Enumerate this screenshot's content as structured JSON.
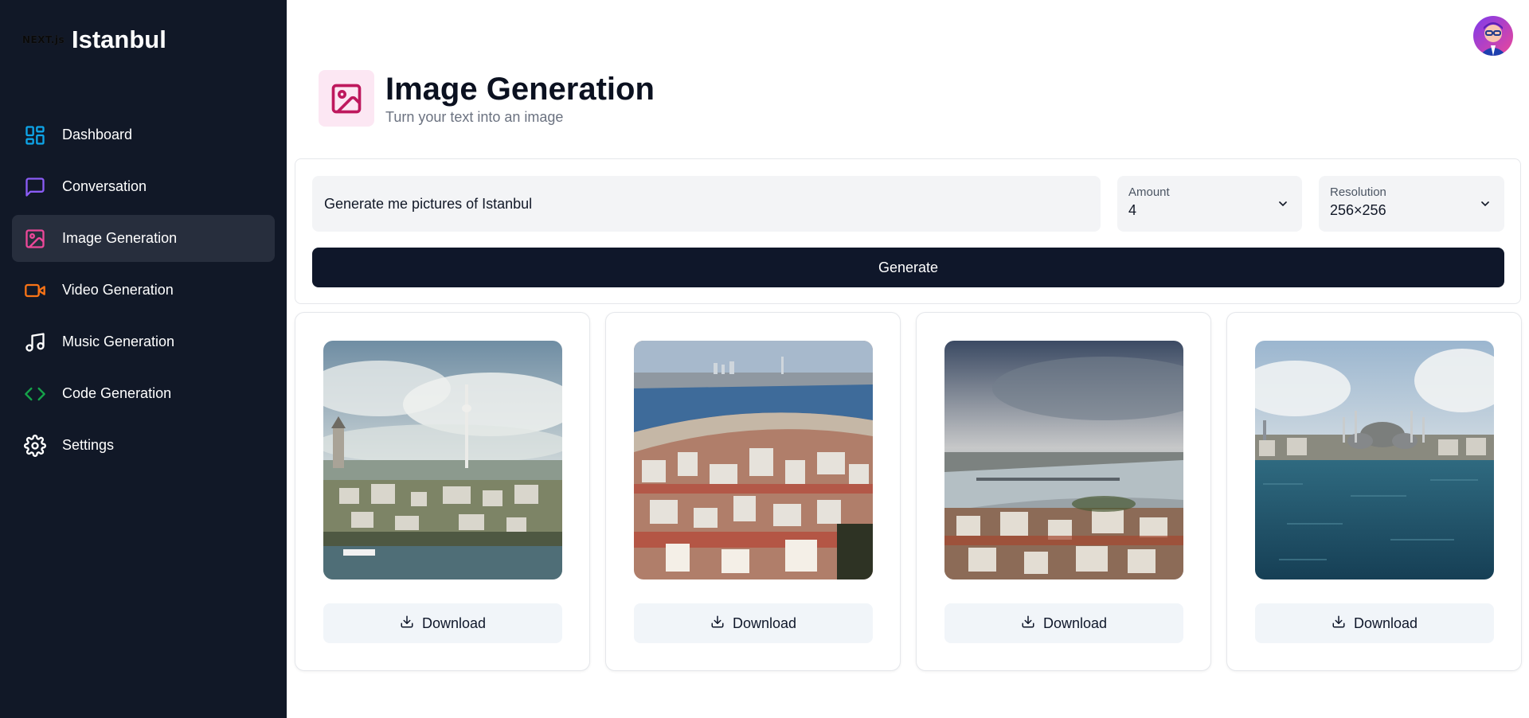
{
  "brand": {
    "logo_text": "NEXT.js",
    "name": "Istanbul"
  },
  "sidebar": {
    "items": [
      {
        "label": "Dashboard",
        "icon": "dashboard-icon",
        "color": "#0ea5e9",
        "active": false
      },
      {
        "label": "Conversation",
        "icon": "message-square-icon",
        "color": "#8b5cf6",
        "active": false
      },
      {
        "label": "Image Generation",
        "icon": "image-icon",
        "color": "#ec4899",
        "active": true
      },
      {
        "label": "Video Generation",
        "icon": "video-icon",
        "color": "#f97316",
        "active": false
      },
      {
        "label": "Music Generation",
        "icon": "music-icon",
        "color": "#ffffff",
        "active": false
      },
      {
        "label": "Code Generation",
        "icon": "code-icon",
        "color": "#16a34a",
        "active": false
      },
      {
        "label": "Settings",
        "icon": "gear-icon",
        "color": "#ffffff",
        "active": false
      }
    ]
  },
  "header": {
    "title": "Image Generation",
    "subtitle": "Turn your text into an image",
    "icon": "image-icon",
    "icon_color": "#be185d",
    "icon_bg": "#fce7f3"
  },
  "form": {
    "prompt_value": "Generate me pictures of Istanbul",
    "amount": {
      "label": "Amount",
      "value": "4"
    },
    "resolution": {
      "label": "Resolution",
      "value": "256×256"
    },
    "generate_label": "Generate"
  },
  "results": [
    {
      "download_label": "Download"
    },
    {
      "download_label": "Download"
    },
    {
      "download_label": "Download"
    },
    {
      "download_label": "Download"
    }
  ],
  "colors": {
    "sidebar_bg": "#111827",
    "active_item_bg": "#272e3d",
    "button_dark": "#0f172a"
  }
}
